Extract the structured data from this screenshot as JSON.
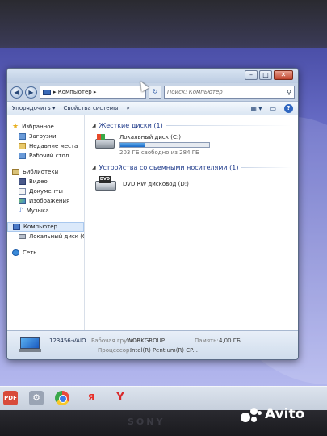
{
  "window": {
    "title": "",
    "caption": {
      "minimize": "–",
      "maximize": "□",
      "close": "✕"
    }
  },
  "addressbar": {
    "back": "◀",
    "forward": "▶",
    "path": "▸ Компьютер ▸",
    "refresh": "↻",
    "search_placeholder": "Поиск: Компьютер",
    "search_icon": "search-icon"
  },
  "toolbar": {
    "organize": "Упорядочить ▾",
    "system_properties": "Свойства системы",
    "more": "»"
  },
  "navpane": {
    "favorites": {
      "label": "Избранное",
      "items": [
        "Загрузки",
        "Недавние места",
        "Рабочий стол"
      ]
    },
    "libraries": {
      "label": "Библиотеки",
      "items": [
        "Видео",
        "Документы",
        "Изображения",
        "Музыка"
      ]
    },
    "computer": {
      "label": "Компьютер",
      "items": [
        "Локальный диск (C"
      ]
    },
    "network": {
      "label": "Сеть"
    }
  },
  "content": {
    "hard_disks": {
      "header": "Жесткие диски (1)",
      "drive": {
        "name": "Локальный диск (C:)",
        "free_text": "203 ГБ свободно из 284 ГБ",
        "used_fraction": 0.285
      }
    },
    "removable": {
      "header": "Устройства со съемными носителями (1)",
      "drive": {
        "name": "DVD RW дисковод (D:)",
        "badge": "DVD"
      }
    }
  },
  "details": {
    "computer_name": "123456-VAIO",
    "workgroup_label": "Рабочая группа:",
    "workgroup": "WORKGROUP",
    "memory_label": "Память:",
    "memory": "4,00 ГБ",
    "cpu_label": "Процессор:",
    "cpu": "Intel(R) Pentium(R) CP..."
  },
  "taskbar": {
    "items": [
      "PDF",
      "⚙",
      "",
      "Я",
      "Y"
    ]
  },
  "device": {
    "brand": "SONY"
  },
  "watermark": {
    "text": "Avito"
  }
}
